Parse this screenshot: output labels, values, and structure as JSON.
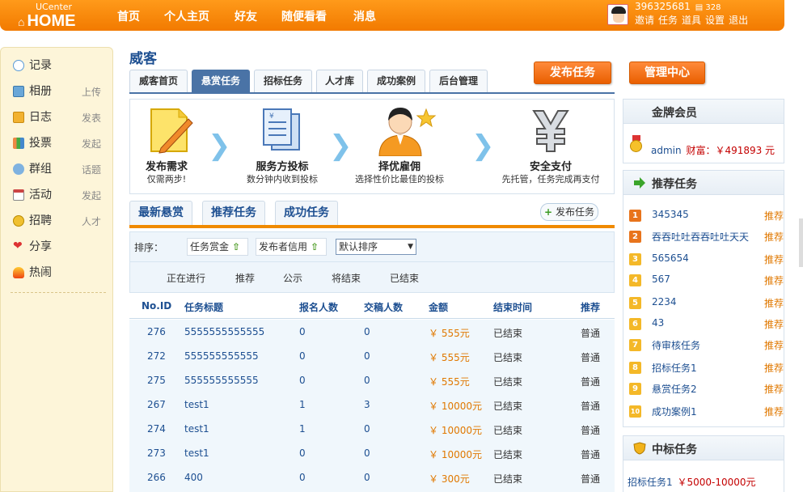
{
  "header": {
    "logo_top": "UCenter",
    "logo_main": "HOME",
    "nav": [
      "首页",
      "个人主页",
      "好友",
      "随便看看",
      "消息"
    ],
    "user_id": "396325681",
    "user_count": "328",
    "user_links": [
      "邀请",
      "任务",
      "道具",
      "设置",
      "退出"
    ],
    "brand_color": "#f58a00"
  },
  "sidebar": {
    "items": [
      {
        "label": "记录",
        "action": "",
        "icon": "speech-bubble-icon"
      },
      {
        "label": "相册",
        "action": "上传",
        "icon": "photo-icon"
      },
      {
        "label": "日志",
        "action": "发表",
        "icon": "notebook-icon"
      },
      {
        "label": "投票",
        "action": "发起",
        "icon": "bar-chart-icon"
      },
      {
        "label": "群组",
        "action": "话题",
        "icon": "group-icon"
      },
      {
        "label": "活动",
        "action": "发起",
        "icon": "calendar-icon"
      },
      {
        "label": "招聘",
        "action": "人才",
        "icon": "coins-icon"
      },
      {
        "label": "分享",
        "action": "",
        "icon": "heart-icon"
      },
      {
        "label": "热闹",
        "action": "",
        "icon": "fire-icon"
      }
    ]
  },
  "page": {
    "title": "威客",
    "tabs": [
      "威客首页",
      "悬赏任务",
      "招标任务",
      "人才库",
      "成功案例",
      "后台管理"
    ],
    "active_tab": "悬赏任务",
    "btn_publish": "发布任务",
    "btn_manage": "管理中心"
  },
  "steps": [
    {
      "title": "发布需求",
      "desc": "仅需两步!",
      "icon": "pencil-note-icon"
    },
    {
      "title": "服务方投标",
      "desc": "数分钟内收到投标",
      "icon": "documents-icon"
    },
    {
      "title": "择优雇佣",
      "desc": "选择性价比最佳的投标",
      "icon": "person-star-icon"
    },
    {
      "title": "安全支付",
      "desc": "先托管，任务完成再支付",
      "icon": "yen-icon"
    }
  ],
  "list": {
    "tabs": [
      "最新悬赏",
      "推荐任务",
      "成功任务"
    ],
    "publish_small": "发布任务",
    "sort_label": "排序：",
    "sort_buttons": [
      "任务赏金",
      "发布者信用"
    ],
    "sort_select": "默认排序",
    "filters": [
      "正在进行",
      "推荐",
      "公示",
      "将结束",
      "已结束"
    ],
    "columns": [
      "No.ID",
      "任务标题",
      "报名人数",
      "交稿人数",
      "金额",
      "结束时间",
      "推荐"
    ],
    "rows": [
      {
        "id": "276",
        "title": "5555555555555",
        "signup": "0",
        "submit": "0",
        "amount": "￥  555元",
        "end": "已结束",
        "rec": "普通"
      },
      {
        "id": "272",
        "title": "555555555555",
        "signup": "0",
        "submit": "0",
        "amount": "￥  555元",
        "end": "已结束",
        "rec": "普通"
      },
      {
        "id": "275",
        "title": "555555555555",
        "signup": "0",
        "submit": "0",
        "amount": "￥  555元",
        "end": "已结束",
        "rec": "普通"
      },
      {
        "id": "267",
        "title": "test1",
        "signup": "1",
        "submit": "3",
        "amount": "￥  10000元",
        "end": "已结束",
        "rec": "普通"
      },
      {
        "id": "274",
        "title": "test1",
        "signup": "1",
        "submit": "0",
        "amount": "￥  10000元",
        "end": "已结束",
        "rec": "普通"
      },
      {
        "id": "273",
        "title": "test1",
        "signup": "0",
        "submit": "0",
        "amount": "￥  10000元",
        "end": "已结束",
        "rec": "普通"
      },
      {
        "id": "266",
        "title": "400",
        "signup": "0",
        "submit": "0",
        "amount": "￥  300元",
        "end": "已结束",
        "rec": "普通"
      }
    ]
  },
  "right": {
    "gold_title": "金牌会员",
    "gold_user": "admin",
    "gold_wealth": "财富：￥491893 元",
    "rec_title": "推荐任务",
    "rec_tag": "推荐",
    "rec_items": [
      "345345",
      "吞吞吐吐吞吞吐吐天天",
      "565654",
      "567",
      "2234",
      "43",
      "待审核任务",
      "招标任务1",
      "悬赏任务2",
      "成功案例1"
    ],
    "bid_title": "中标任务",
    "bid_item": "招标任务1",
    "bid_amount": "￥5000-10000元"
  }
}
